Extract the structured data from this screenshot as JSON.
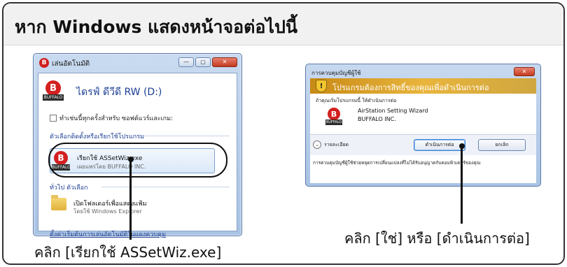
{
  "heading": "หาก Windows แสดงหน้าจอต่อไปนี้",
  "autoplay": {
    "title": "เล่นอัตโนมัติ",
    "window_buttons": [
      "—",
      "▢",
      "✕"
    ],
    "drive_title": "ไดรฟ์ ดีวีดี RW (D:)",
    "checkbox_label": "ทำเช่นนี้ทุกครั้งสำหรับ ซอฟต์แวร์และเกม:",
    "section_install": "ตัวเลือกติดตั้งหรือเรียกใช้โปรแกรม",
    "run_option": {
      "label": "เรียกใช้ ASSetWiz.exe",
      "sublabel": "เผยแพร่โดย BUFFALO INC."
    },
    "section_general": "ทั่วไป ตัวเลือก",
    "folder_option": {
      "label": "เปิดโฟลเดอร์เพื่อแสดงแฟ้ม",
      "sublabel": "โดยใช้ Windows Explorer"
    },
    "control_panel_link": "ตั้งค่าเริ่มต้นการเล่นอัตโนมัติในแผงควบคุม",
    "badge_letter": "B",
    "badge_caption": "BUFFALO"
  },
  "uac": {
    "title": "การควบคุมบัญชีผู้ใช้",
    "close": "✕",
    "banner": "โปรแกรมต้องการสิทธิ์ของคุณเพื่อดำเนินการต่อ",
    "question": "ถ้าคุณเริ่มโปรแกรมนี้ ให้ดำเนินการต่อ",
    "program_name": "AirStation Setting Wizard",
    "publisher": "BUFFALO INC.",
    "details": "รายละเอียด",
    "continue_label": "ดำเนินการต่อ",
    "cancel_label": "ยกเลิก",
    "footer": "การควบคุมบัญชีผู้ใช้ช่วยหยุดการเปลี่ยนแปลงที่ไม่ได้รับอนุญาตกับคอมพิวเตอร์ของคุณ"
  },
  "callouts": {
    "left": "คลิก [เรียกใช้ ASSetWiz.exe]",
    "right": "คลิก [ใช่] หรือ [ดำเนินการต่อ]"
  }
}
